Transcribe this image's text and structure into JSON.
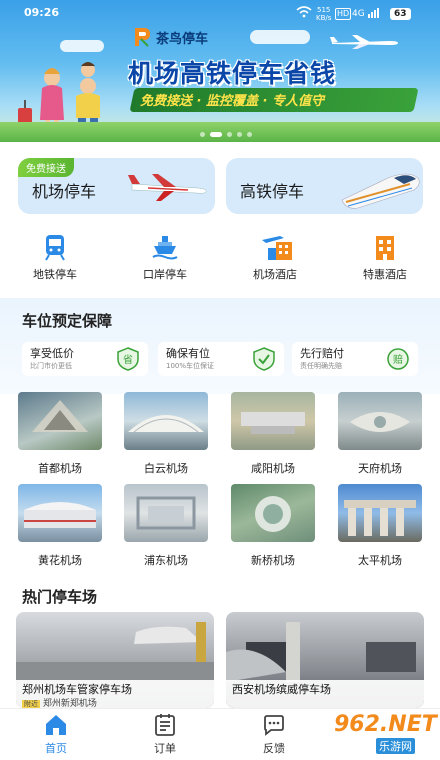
{
  "status_bar": {
    "time": "09:26",
    "net_speed": "515",
    "net_unit": "KB/s",
    "hd": "HD",
    "signal": "4G",
    "battery": "63"
  },
  "banner": {
    "brand": "茶鸟停车",
    "slogan": "机场高铁停车省钱",
    "ribbon": "免费接送 · 监控覆盖 · 专人值守"
  },
  "parking": {
    "airport": {
      "label": "机场停车",
      "tag": "免费接送"
    },
    "rail": {
      "label": "高铁停车"
    }
  },
  "quick_nav": [
    {
      "label": "地铁停车",
      "icon": "metro-icon"
    },
    {
      "label": "口岸停车",
      "icon": "ship-icon"
    },
    {
      "label": "机场酒店",
      "icon": "airport-hotel-icon"
    },
    {
      "label": "特惠酒店",
      "icon": "discount-hotel-icon"
    }
  ],
  "guarantee": {
    "title": "车位预定保障",
    "items": [
      {
        "title": "享受低价",
        "desc": "比门市价更低",
        "badge": "省"
      },
      {
        "title": "确保有位",
        "desc": "100%车位保证",
        "badge": "✓"
      },
      {
        "title": "先行赔付",
        "desc": "责任明确先赔",
        "badge": "赔"
      }
    ]
  },
  "airports": [
    {
      "name": "首都机场"
    },
    {
      "name": "白云机场"
    },
    {
      "name": "咸阳机场"
    },
    {
      "name": "天府机场"
    },
    {
      "name": "黄花机场"
    },
    {
      "name": "浦东机场"
    },
    {
      "name": "新桥机场"
    },
    {
      "name": "太平机场"
    }
  ],
  "hot": {
    "title": "热门停车场",
    "lots": [
      {
        "name": "郑州机场车管家停车场",
        "desc": "郑州新郑机场",
        "tag": "附近"
      },
      {
        "name": "西安机场缤威停车场",
        "desc": ""
      }
    ]
  },
  "tabs": [
    {
      "label": "首页",
      "active": true
    },
    {
      "label": "订单",
      "active": false
    },
    {
      "label": "反馈",
      "active": false
    }
  ],
  "watermark": {
    "big": "962.NET",
    "small": "乐游网"
  },
  "colors": {
    "primary": "#2b8ae6",
    "brand_blue": "#0a47a8",
    "green": "#3aa23a",
    "card_bg": "#d6eafb"
  }
}
